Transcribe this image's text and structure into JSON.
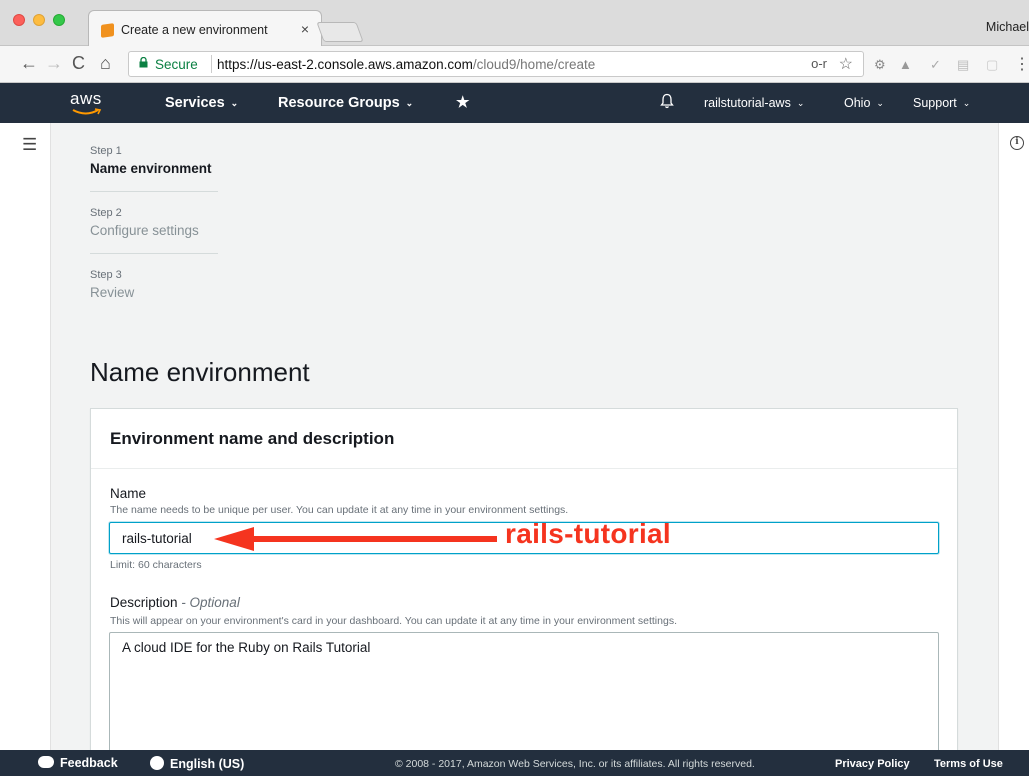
{
  "browser": {
    "tab_title": "Create a new environment",
    "tab_close": "×",
    "profile_name": "Michael",
    "secure_label": "Secure",
    "url_scheme": "https://",
    "url_host": "us-east-2.console.aws.amazon.com",
    "url_path": "/cloud9/home/create",
    "nav_back": "←",
    "nav_forward": "→",
    "nav_reload": "C",
    "nav_home": "⌂",
    "key_icon_glyph": "o-r",
    "star_icon_glyph": "☆",
    "menu_glyph": "⋮"
  },
  "aws_header": {
    "logo_text": "aws",
    "services_label": "Services",
    "resource_groups_label": "Resource Groups",
    "pin_glyph": "★",
    "bell_glyph": "🔔",
    "account_label": "railstutorial-aws",
    "region_label": "Ohio",
    "support_label": "Support",
    "caret": "⌄"
  },
  "steps": [
    {
      "label": "Step 1",
      "name": "Name environment",
      "active": true
    },
    {
      "label": "Step 2",
      "name": "Configure settings",
      "active": false
    },
    {
      "label": "Step 3",
      "name": "Review",
      "active": false
    }
  ],
  "page_title": "Name environment",
  "panel": {
    "title": "Environment name and description",
    "name_label": "Name",
    "name_hint": "The name needs to be unique per user. You can update it at any time in your environment settings.",
    "name_value": "rails-tutorial",
    "name_limit": "Limit: 60 characters",
    "description_label": "Description",
    "description_optional": "Optional",
    "description_separator": " - ",
    "description_hint": "This will appear on your environment's card in your dashboard. You can update it at any time in your environment settings.",
    "description_value": "A cloud IDE for the Ruby on Rails Tutorial"
  },
  "annotation": {
    "text": "rails-tutorial",
    "color": "#f5341f"
  },
  "footer": {
    "feedback_label": "Feedback",
    "language_label": "English (US)",
    "copyright": "© 2008 - 2017, Amazon Web Services, Inc. or its affiliates. All rights reserved.",
    "privacy_label": "Privacy Policy",
    "terms_label": "Terms of Use"
  },
  "colors": {
    "aws_navy": "#232f3e",
    "aws_orange": "#ff9900",
    "focus_blue": "#00a1c9",
    "secure_green": "#0b8043"
  },
  "icons": [
    "hamburger-icon",
    "info-icon",
    "bell-icon",
    "pin-icon",
    "lock-icon",
    "key-icon",
    "star-icon",
    "feedback-bubble-icon",
    "globe-icon"
  ]
}
